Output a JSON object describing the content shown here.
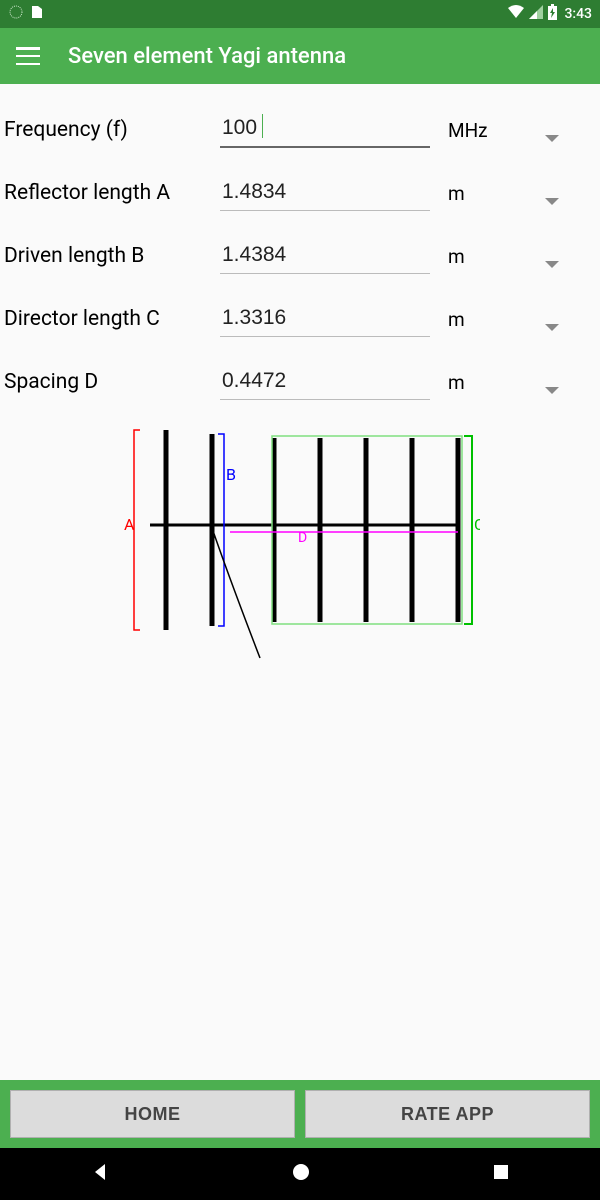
{
  "status": {
    "time": "3:43"
  },
  "header": {
    "title": "Seven element Yagi antenna"
  },
  "rows": [
    {
      "label": "Frequency (f)",
      "value": "100",
      "unit": "MHz",
      "active": true
    },
    {
      "label": "Reflector length A",
      "value": "1.4834",
      "unit": "m"
    },
    {
      "label": "Driven length B",
      "value": "1.4384",
      "unit": "m"
    },
    {
      "label": "Director length C",
      "value": "1.3316",
      "unit": "m"
    },
    {
      "label": "Spacing D",
      "value": "0.4472",
      "unit": "m"
    }
  ],
  "diagram": {
    "A": "A",
    "B": "B",
    "C": "C",
    "D": "D"
  },
  "buttons": {
    "home": "HOME",
    "rate": "RATE APP"
  }
}
